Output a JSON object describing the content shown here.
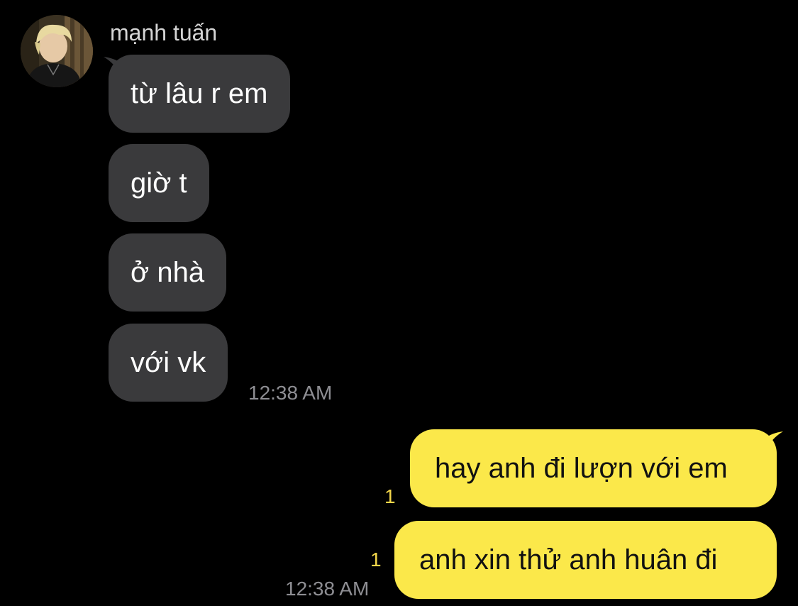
{
  "contact": {
    "name": "mạnh tuấn",
    "avatar_icon": "avatar-photo-icon"
  },
  "incoming": {
    "messages": [
      {
        "text": "từ lâu r em"
      },
      {
        "text": "giờ t"
      },
      {
        "text": "ở nhà"
      },
      {
        "text": "với vk"
      }
    ],
    "timestamp": "12:38 AM"
  },
  "outgoing": {
    "messages": [
      {
        "text": "hay anh đi lượn với em",
        "read_count": "1"
      },
      {
        "text": "anh xin thử anh huân đi",
        "read_count": "1"
      }
    ],
    "timestamp": "12:38 AM"
  },
  "colors": {
    "background": "#000000",
    "incoming_bubble": "#3a3a3c",
    "outgoing_bubble": "#fbe84a",
    "read_count": "#f3d64a",
    "timestamp": "#8e8e93"
  }
}
